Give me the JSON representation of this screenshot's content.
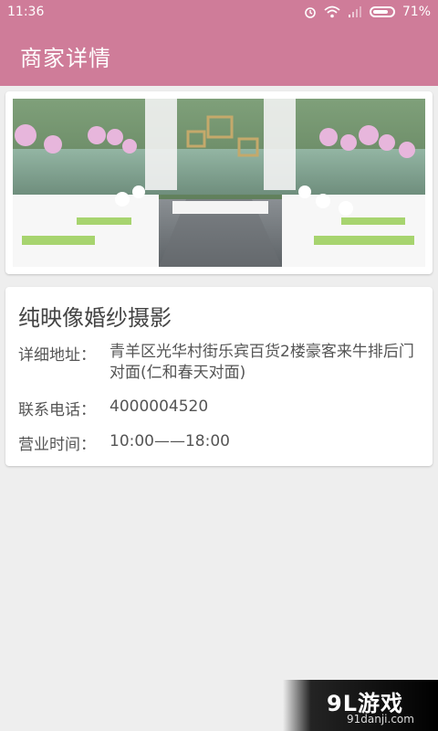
{
  "status_bar": {
    "time": "11:36",
    "battery_text": "71%",
    "icons": [
      "alarm-icon",
      "wifi-icon",
      "signal-icon",
      "battery-icon"
    ]
  },
  "app_bar": {
    "title": "商家详情",
    "color": "#cf7c99"
  },
  "store": {
    "name": "纯映像婚纱摄影",
    "address_label": "详细地址：",
    "address": "青羊区光华村街乐宾百货2楼豪客来牛排后门对面(仁和春天对面)",
    "phone_label": "联系电话：",
    "phone": "4000004520",
    "hours_label": "营业时间：",
    "hours": "10:00——18:00"
  },
  "watermark": {
    "brand": "9L游戏",
    "site": "91danji.com"
  }
}
